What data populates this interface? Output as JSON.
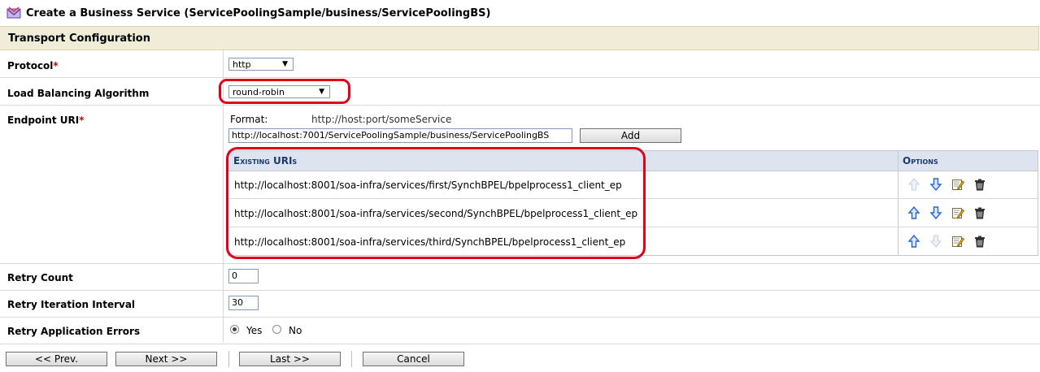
{
  "window": {
    "title": "Create a Business Service (ServicePoolingSample/business/ServicePoolingBS)"
  },
  "section": {
    "title": "Transport Configuration"
  },
  "protocol": {
    "label": "Protocol",
    "required_mark": "*",
    "value": "http"
  },
  "load_balancing": {
    "label": "Load Balancing Algorithm",
    "value": "round-robin"
  },
  "endpoint": {
    "label": "Endpoint URI",
    "required_mark": "*",
    "format_label": "Format:",
    "format_value": "http://host:port/someService",
    "input_value": "http://localhost:7001/ServicePoolingSample/business/ServicePoolingBS",
    "add_button": "Add",
    "table": {
      "col_uris": "Existing URIs",
      "col_options": "Options",
      "rows": [
        {
          "uri": "http://localhost:8001/soa-infra/services/first/SynchBPEL/bpelprocess1_client_ep"
        },
        {
          "uri": "http://localhost:8001/soa-infra/services/second/SynchBPEL/bpelprocess1_client_ep"
        },
        {
          "uri": "http://localhost:8001/soa-infra/services/third/SynchBPEL/bpelprocess1_client_ep"
        }
      ]
    }
  },
  "retry_count": {
    "label": "Retry Count",
    "value": "0"
  },
  "retry_interval": {
    "label": "Retry Iteration Interval",
    "value": "30"
  },
  "retry_errors": {
    "label": "Retry Application Errors",
    "yes": "Yes",
    "no": "No",
    "selected": "Yes"
  },
  "footer": {
    "prev": "<< Prev.",
    "next": "Next >>",
    "last": "Last >>",
    "cancel": "Cancel"
  },
  "colors": {
    "highlight": "#e0001a",
    "section_bg": "#efecd8",
    "table_header_bg": "#dde4ef",
    "arrow_active": "#2a66c9",
    "arrow_disabled": "#c6cfdc"
  },
  "icons": [
    "service-logo-icon",
    "arrow-up-icon",
    "arrow-down-icon",
    "edit-icon",
    "delete-icon"
  ]
}
